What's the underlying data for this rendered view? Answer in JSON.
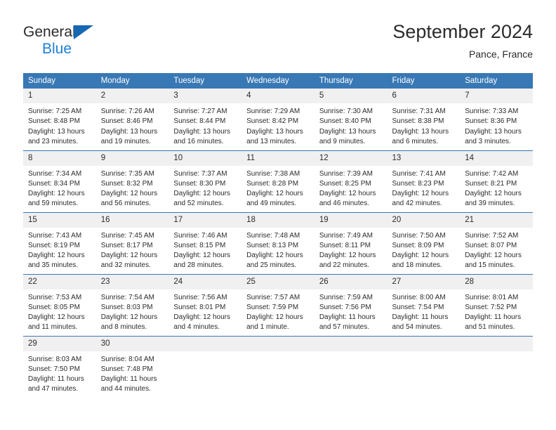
{
  "brand": {
    "name_part1": "General",
    "name_part2": "Blue",
    "triangle_icon": "triangle-icon",
    "accent_color": "#1f7fd4",
    "logo_dark_color": "#2b2b2b"
  },
  "header": {
    "title": "September 2024",
    "location": "Pance, France",
    "header_bg_color": "#3878b4",
    "daynum_bg_color": "#f0f0f0"
  },
  "weekdays": [
    "Sunday",
    "Monday",
    "Tuesday",
    "Wednesday",
    "Thursday",
    "Friday",
    "Saturday"
  ],
  "labels": {
    "sunrise": "Sunrise:",
    "sunset": "Sunset:",
    "daylight": "Daylight:"
  },
  "weeks": [
    [
      {
        "day": "1",
        "sunrise": "Sunrise: 7:25 AM",
        "sunset": "Sunset: 8:48 PM",
        "daylight_line1": "Daylight: 13 hours",
        "daylight_line2": "and 23 minutes."
      },
      {
        "day": "2",
        "sunrise": "Sunrise: 7:26 AM",
        "sunset": "Sunset: 8:46 PM",
        "daylight_line1": "Daylight: 13 hours",
        "daylight_line2": "and 19 minutes."
      },
      {
        "day": "3",
        "sunrise": "Sunrise: 7:27 AM",
        "sunset": "Sunset: 8:44 PM",
        "daylight_line1": "Daylight: 13 hours",
        "daylight_line2": "and 16 minutes."
      },
      {
        "day": "4",
        "sunrise": "Sunrise: 7:29 AM",
        "sunset": "Sunset: 8:42 PM",
        "daylight_line1": "Daylight: 13 hours",
        "daylight_line2": "and 13 minutes."
      },
      {
        "day": "5",
        "sunrise": "Sunrise: 7:30 AM",
        "sunset": "Sunset: 8:40 PM",
        "daylight_line1": "Daylight: 13 hours",
        "daylight_line2": "and 9 minutes."
      },
      {
        "day": "6",
        "sunrise": "Sunrise: 7:31 AM",
        "sunset": "Sunset: 8:38 PM",
        "daylight_line1": "Daylight: 13 hours",
        "daylight_line2": "and 6 minutes."
      },
      {
        "day": "7",
        "sunrise": "Sunrise: 7:33 AM",
        "sunset": "Sunset: 8:36 PM",
        "daylight_line1": "Daylight: 13 hours",
        "daylight_line2": "and 3 minutes."
      }
    ],
    [
      {
        "day": "8",
        "sunrise": "Sunrise: 7:34 AM",
        "sunset": "Sunset: 8:34 PM",
        "daylight_line1": "Daylight: 12 hours",
        "daylight_line2": "and 59 minutes."
      },
      {
        "day": "9",
        "sunrise": "Sunrise: 7:35 AM",
        "sunset": "Sunset: 8:32 PM",
        "daylight_line1": "Daylight: 12 hours",
        "daylight_line2": "and 56 minutes."
      },
      {
        "day": "10",
        "sunrise": "Sunrise: 7:37 AM",
        "sunset": "Sunset: 8:30 PM",
        "daylight_line1": "Daylight: 12 hours",
        "daylight_line2": "and 52 minutes."
      },
      {
        "day": "11",
        "sunrise": "Sunrise: 7:38 AM",
        "sunset": "Sunset: 8:28 PM",
        "daylight_line1": "Daylight: 12 hours",
        "daylight_line2": "and 49 minutes."
      },
      {
        "day": "12",
        "sunrise": "Sunrise: 7:39 AM",
        "sunset": "Sunset: 8:25 PM",
        "daylight_line1": "Daylight: 12 hours",
        "daylight_line2": "and 46 minutes."
      },
      {
        "day": "13",
        "sunrise": "Sunrise: 7:41 AM",
        "sunset": "Sunset: 8:23 PM",
        "daylight_line1": "Daylight: 12 hours",
        "daylight_line2": "and 42 minutes."
      },
      {
        "day": "14",
        "sunrise": "Sunrise: 7:42 AM",
        "sunset": "Sunset: 8:21 PM",
        "daylight_line1": "Daylight: 12 hours",
        "daylight_line2": "and 39 minutes."
      }
    ],
    [
      {
        "day": "15",
        "sunrise": "Sunrise: 7:43 AM",
        "sunset": "Sunset: 8:19 PM",
        "daylight_line1": "Daylight: 12 hours",
        "daylight_line2": "and 35 minutes."
      },
      {
        "day": "16",
        "sunrise": "Sunrise: 7:45 AM",
        "sunset": "Sunset: 8:17 PM",
        "daylight_line1": "Daylight: 12 hours",
        "daylight_line2": "and 32 minutes."
      },
      {
        "day": "17",
        "sunrise": "Sunrise: 7:46 AM",
        "sunset": "Sunset: 8:15 PM",
        "daylight_line1": "Daylight: 12 hours",
        "daylight_line2": "and 28 minutes."
      },
      {
        "day": "18",
        "sunrise": "Sunrise: 7:48 AM",
        "sunset": "Sunset: 8:13 PM",
        "daylight_line1": "Daylight: 12 hours",
        "daylight_line2": "and 25 minutes."
      },
      {
        "day": "19",
        "sunrise": "Sunrise: 7:49 AM",
        "sunset": "Sunset: 8:11 PM",
        "daylight_line1": "Daylight: 12 hours",
        "daylight_line2": "and 22 minutes."
      },
      {
        "day": "20",
        "sunrise": "Sunrise: 7:50 AM",
        "sunset": "Sunset: 8:09 PM",
        "daylight_line1": "Daylight: 12 hours",
        "daylight_line2": "and 18 minutes."
      },
      {
        "day": "21",
        "sunrise": "Sunrise: 7:52 AM",
        "sunset": "Sunset: 8:07 PM",
        "daylight_line1": "Daylight: 12 hours",
        "daylight_line2": "and 15 minutes."
      }
    ],
    [
      {
        "day": "22",
        "sunrise": "Sunrise: 7:53 AM",
        "sunset": "Sunset: 8:05 PM",
        "daylight_line1": "Daylight: 12 hours",
        "daylight_line2": "and 11 minutes."
      },
      {
        "day": "23",
        "sunrise": "Sunrise: 7:54 AM",
        "sunset": "Sunset: 8:03 PM",
        "daylight_line1": "Daylight: 12 hours",
        "daylight_line2": "and 8 minutes."
      },
      {
        "day": "24",
        "sunrise": "Sunrise: 7:56 AM",
        "sunset": "Sunset: 8:01 PM",
        "daylight_line1": "Daylight: 12 hours",
        "daylight_line2": "and 4 minutes."
      },
      {
        "day": "25",
        "sunrise": "Sunrise: 7:57 AM",
        "sunset": "Sunset: 7:59 PM",
        "daylight_line1": "Daylight: 12 hours",
        "daylight_line2": "and 1 minute."
      },
      {
        "day": "26",
        "sunrise": "Sunrise: 7:59 AM",
        "sunset": "Sunset: 7:56 PM",
        "daylight_line1": "Daylight: 11 hours",
        "daylight_line2": "and 57 minutes."
      },
      {
        "day": "27",
        "sunrise": "Sunrise: 8:00 AM",
        "sunset": "Sunset: 7:54 PM",
        "daylight_line1": "Daylight: 11 hours",
        "daylight_line2": "and 54 minutes."
      },
      {
        "day": "28",
        "sunrise": "Sunrise: 8:01 AM",
        "sunset": "Sunset: 7:52 PM",
        "daylight_line1": "Daylight: 11 hours",
        "daylight_line2": "and 51 minutes."
      }
    ],
    [
      {
        "day": "29",
        "sunrise": "Sunrise: 8:03 AM",
        "sunset": "Sunset: 7:50 PM",
        "daylight_line1": "Daylight: 11 hours",
        "daylight_line2": "and 47 minutes."
      },
      {
        "day": "30",
        "sunrise": "Sunrise: 8:04 AM",
        "sunset": "Sunset: 7:48 PM",
        "daylight_line1": "Daylight: 11 hours",
        "daylight_line2": "and 44 minutes."
      },
      {
        "day": "",
        "sunrise": "",
        "sunset": "",
        "daylight_line1": "",
        "daylight_line2": ""
      },
      {
        "day": "",
        "sunrise": "",
        "sunset": "",
        "daylight_line1": "",
        "daylight_line2": ""
      },
      {
        "day": "",
        "sunrise": "",
        "sunset": "",
        "daylight_line1": "",
        "daylight_line2": ""
      },
      {
        "day": "",
        "sunrise": "",
        "sunset": "",
        "daylight_line1": "",
        "daylight_line2": ""
      },
      {
        "day": "",
        "sunrise": "",
        "sunset": "",
        "daylight_line1": "",
        "daylight_line2": ""
      }
    ]
  ]
}
